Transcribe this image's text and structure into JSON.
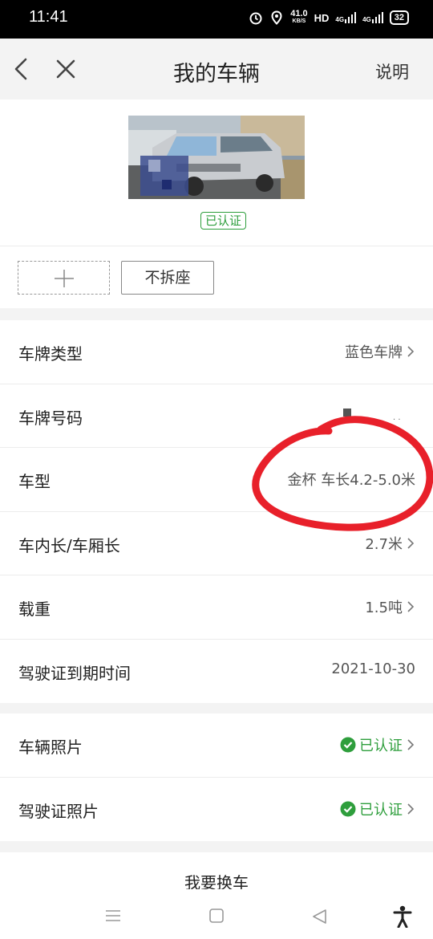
{
  "status_bar": {
    "time": "11:41",
    "speed_value": "41.0",
    "speed_unit": "KB/S",
    "hd_label": "HD",
    "net_1": "4G",
    "net_2": "4G",
    "battery": "32"
  },
  "nav": {
    "title": "我的车辆",
    "help_label": "说明",
    "back_icon": "chevron-left-icon",
    "close_icon": "close-icon"
  },
  "vehicle": {
    "verified_badge": "已认证",
    "seat_tag": "不拆座"
  },
  "details": [
    {
      "label": "车牌类型",
      "value": "蓝色车牌"
    },
    {
      "label": "车牌号码",
      "value": ""
    },
    {
      "label": "车型",
      "value": "金杯 车长4.2-5.0米"
    },
    {
      "label": "车内长/车厢长",
      "value": "2.7米"
    },
    {
      "label": "载重",
      "value": "1.5吨"
    },
    {
      "label": "驾驶证到期时间",
      "value": "2021-10-30"
    }
  ],
  "documents": [
    {
      "label": "车辆照片",
      "value": "已认证"
    },
    {
      "label": "驾驶证照片",
      "value": "已认证"
    }
  ],
  "bottom": {
    "change_car": "我要换车"
  },
  "colors": {
    "accent_green": "#2e9e3c",
    "annotation_red": "#e8202a"
  }
}
